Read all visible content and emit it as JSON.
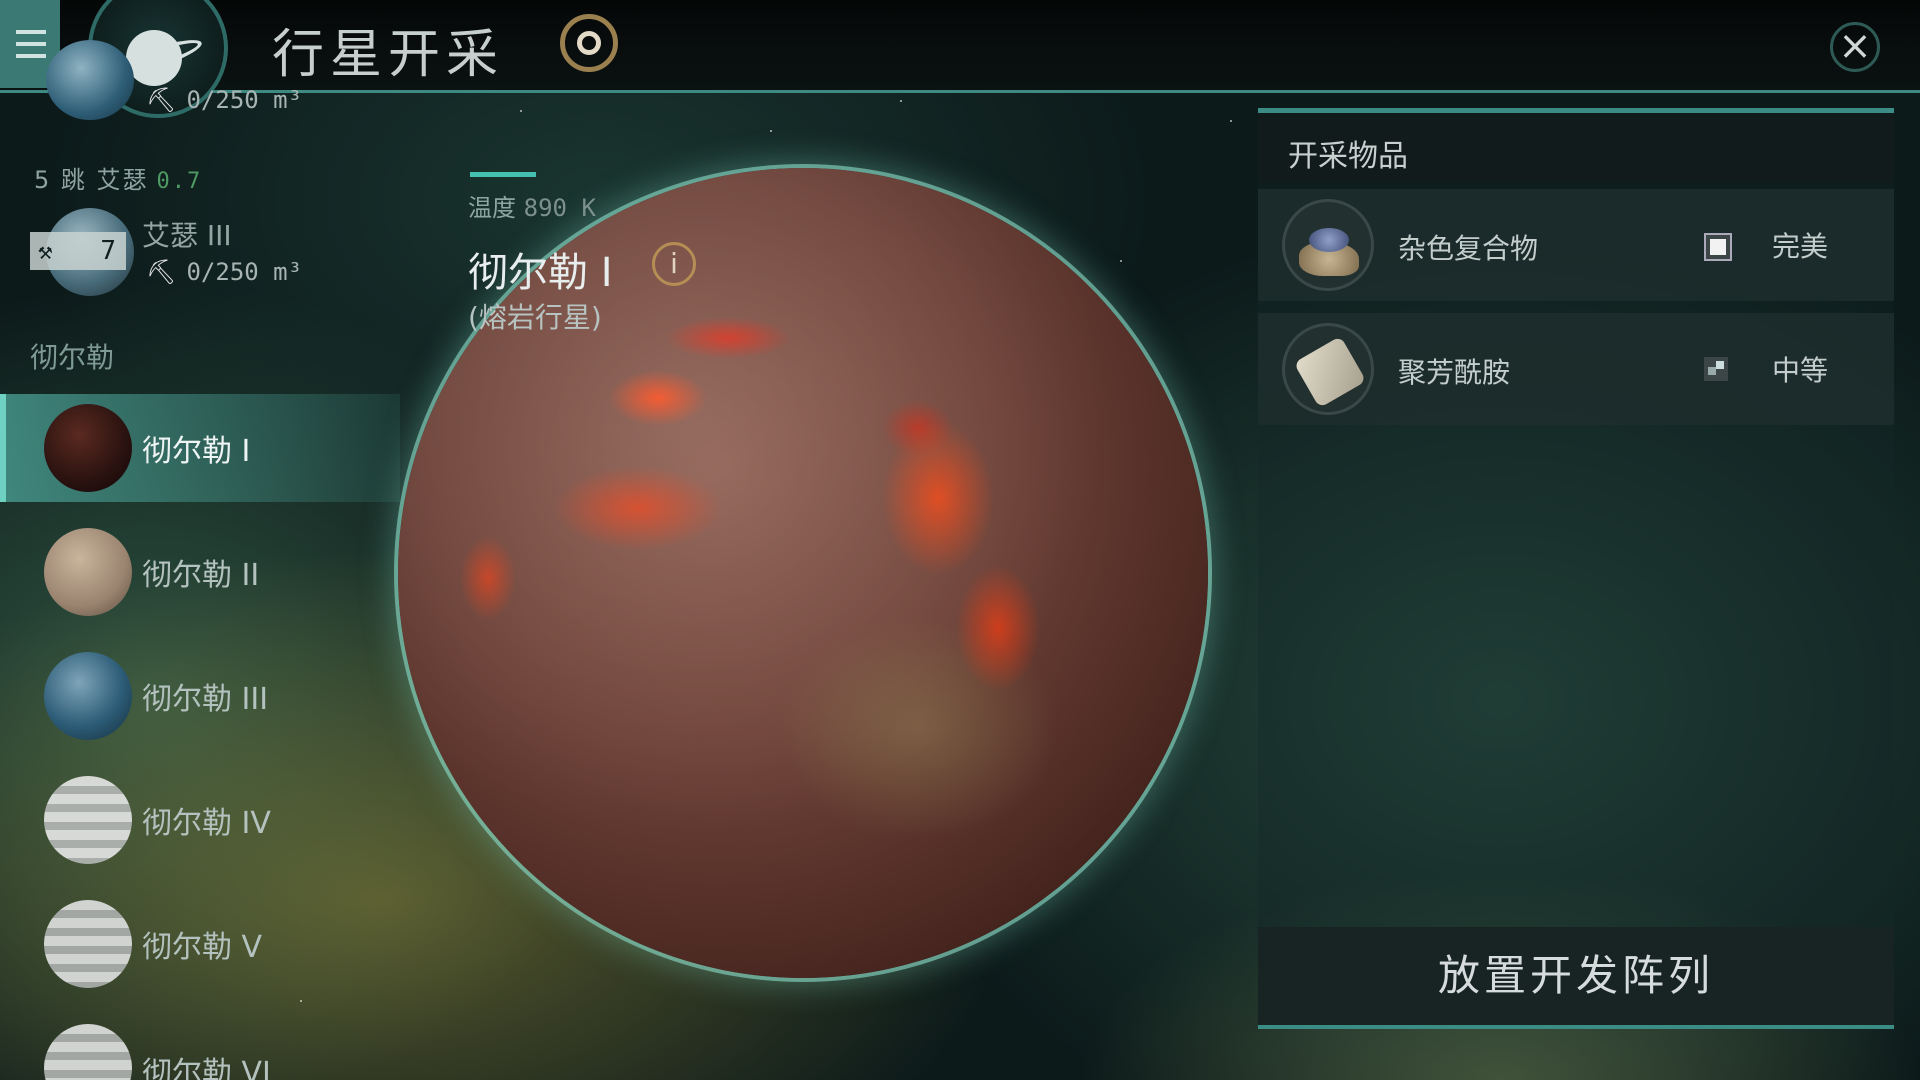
{
  "header": {
    "title": "行星开采",
    "menu_icon": "hamburger-menu-icon",
    "planet_icon": "ringed-planet-icon",
    "scan_icon": "target-scan-icon",
    "close_icon": "close-icon",
    "close_glyph": "×"
  },
  "sidebar": {
    "top_item": {
      "capacity": "0/250 m³"
    },
    "systems": [
      {
        "header": "5 跳 艾瑟",
        "security": "0.7",
        "planet": {
          "name": "艾瑟 III",
          "level": "7",
          "capacity": "0/250 m³"
        }
      }
    ],
    "group_label": "彻尔勒",
    "items": [
      {
        "label": "彻尔勒 I",
        "active": true
      },
      {
        "label": "彻尔勒 II",
        "active": false
      },
      {
        "label": "彻尔勒 III",
        "active": false
      },
      {
        "label": "彻尔勒 IV",
        "active": false
      },
      {
        "label": "彻尔勒 V",
        "active": false
      },
      {
        "label": "彻尔勒 VI",
        "active": false
      }
    ]
  },
  "planet_info": {
    "temp_label": "温度",
    "temp_value": "890 K",
    "name": "彻尔勒 I",
    "info_glyph": "i",
    "type": "(熔岩行星)"
  },
  "resources": {
    "title": "开采物品",
    "items": [
      {
        "name": "杂色复合物",
        "quality": "完美",
        "icon": "composite-ore-icon"
      },
      {
        "name": "聚芳酰胺",
        "quality": "中等",
        "icon": "polyaramid-roll-icon"
      }
    ],
    "action_button": "放置开发阵列"
  },
  "colors": {
    "accent": "#3a8c84",
    "active_row": "#46968c",
    "lava": "#e84a1c"
  }
}
